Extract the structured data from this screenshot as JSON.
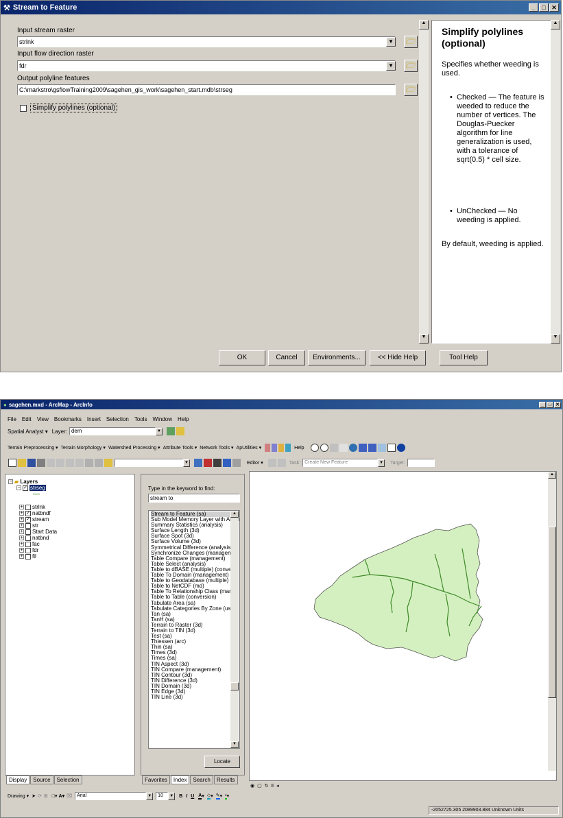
{
  "dialog": {
    "title": "Stream to Feature",
    "label_stream": "Input stream raster",
    "value_stream": "strlnk",
    "label_fdr": "Input flow direction raster",
    "value_fdr": "fdr",
    "label_output": "Output polyline features",
    "value_output": "C:\\markstro\\gsflowTraining2009\\sagehen_gis_work\\sagehen_start.mdb\\strseg",
    "simplify_label": "Simplify polylines (optional)",
    "help_title": "Simplify polylines (optional)",
    "help_intro": "Specifies whether weeding is used.",
    "help_checked": "Checked — The feature is weeded to reduce the number of vertices. The Douglas-Puecker algorithm for line generalization is used, with a tolerance of sqrt(0.5) * cell size.",
    "help_unchecked": "UnChecked — No weeding is applied.",
    "help_default": "By default, weeding is applied.",
    "buttons": {
      "ok": "OK",
      "cancel": "Cancel",
      "environments": "Environments...",
      "hide_help": "<< Hide Help",
      "tool_help": "Tool Help"
    }
  },
  "arcmap": {
    "title": "sagehen.mxd - ArcMap - ArcInfo",
    "menu": [
      "File",
      "Edit",
      "View",
      "Bookmarks",
      "Insert",
      "Selection",
      "Tools",
      "Window",
      "Help"
    ],
    "spatial_analyst": "Spatial Analyst ▾",
    "layer_label": "Layer:",
    "layer_value": "dem",
    "toolbar_menus": [
      "Terrain Preprocessing ▾",
      "Terrain Morphology ▾",
      "Watershed Processing ▾",
      "Attribute Tools ▾",
      "Network Tools ▾",
      "ApUtilities ▾"
    ],
    "help": "Help",
    "editor": "Editor ▾",
    "task_label": "Task:",
    "task_value": "Create New Feature",
    "target_label": "Target:",
    "toc": {
      "root": "Layers",
      "layers": [
        {
          "name": "strseg",
          "checked": "✓"
        },
        {
          "name": "strlnk",
          "checked": ""
        },
        {
          "name": "natbndf",
          "checked": "✓"
        },
        {
          "name": "stream",
          "checked": "✓"
        },
        {
          "name": "str",
          "checked": ""
        },
        {
          "name": "Start Data",
          "checked": ""
        },
        {
          "name": "natbnd",
          "checked": ""
        },
        {
          "name": "fac",
          "checked": ""
        },
        {
          "name": "fdr",
          "checked": ""
        },
        {
          "name": "fil",
          "checked": ""
        }
      ],
      "tabs": [
        "Display",
        "Source",
        "Selection"
      ]
    },
    "search": {
      "prompt": "Type in the keyword to find:",
      "query": "stream to",
      "items": [
        "Stream to Feature (sa)",
        "Sub Model Memory Layer with All Jo",
        "Summary Statistics (analysis)",
        "Surface Length (3d)",
        "Surface Spot (3d)",
        "Surface Volume (3d)",
        "Symmetrical Difference (analysis)",
        "Synchronize Changes (managemer",
        "Table Compare (management)",
        "Table Select (analysis)",
        "Table to dBASE (multiple) (conversi",
        "Table To Domain (management)",
        "Table to Geodatabase (multiple) (cc",
        "Table to NetCDF (md)",
        "Table To Relationship Class (mana",
        "Table to Table (conversion)",
        "Tabulate Area (sa)",
        "Tabulate Categories By Zone (usgs",
        "Tan (sa)",
        "TanH (sa)",
        "Terrain to Raster (3d)",
        "Terrain to TIN (3d)",
        "Test (sa)",
        "Thiessen (arc)",
        "Thin (sa)",
        "Times (3d)",
        "Times (sa)",
        "TIN Aspect (3d)",
        "TIN Compare (management)",
        "TIN Contour (3d)",
        "TIN Difference (3d)",
        "TIN Domain (3d)",
        "TIN Edge (3d)",
        "TIN Line (3d)"
      ],
      "locate": "Locate",
      "tabs": [
        "Favorites",
        "Index",
        "Search",
        "Results"
      ]
    },
    "drawing": "Drawing ▾",
    "font": "Arial",
    "font_size": "10",
    "status": "-2052725.305  2089903.884 Unknown Units",
    "colors": {
      "watershed": "#d4f0c0",
      "stream": "#3f8a2a",
      "titlebar": "#0a246a"
    }
  }
}
